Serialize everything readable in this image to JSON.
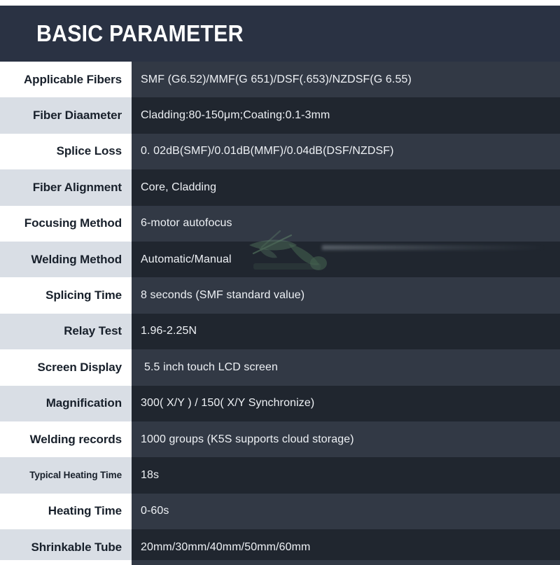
{
  "header": {
    "title": "BASIC PARAMETER"
  },
  "table": {
    "rows": [
      {
        "label": "Applicable Fibers",
        "value": "SMF (G6.52)/MMF(G 651)/DSF(.653)/NZDSF(G 6.55)"
      },
      {
        "label": "Fiber Diaameter",
        "value": "Cladding:80-150μm;Coating:0.1-3mm"
      },
      {
        "label": "Splice Loss",
        "value": "0. 02dB(SMF)/0.01dB(MMF)/0.04dB(DSF/NZDSF)"
      },
      {
        "label": "Fiber Alignment",
        "value": "Core, Cladding"
      },
      {
        "label": "Focusing Method",
        "value": "6-motor autofocus"
      },
      {
        "label": "Welding Method",
        "value": "Automatic/Manual"
      },
      {
        "label": "Splicing Time",
        "value": "8 seconds (SMF standard value)"
      },
      {
        "label": "Relay Test",
        "value": "1.96-2.25N"
      },
      {
        "label": "Screen Display",
        "value": "5.5 inch touch LCD screen"
      },
      {
        "label": "Magnification",
        "value": "300( X/Y ) / 150( X/Y  Synchronize)"
      },
      {
        "label": "Welding records",
        "value": "1000 groups (K5S supports cloud storage)"
      },
      {
        "label": "Typical Heating Time",
        "value": "18s"
      },
      {
        "label": "Heating Time",
        "value": "0-60s"
      },
      {
        "label": "Shrinkable Tube",
        "value": "20mm/30mm/40mm/50mm/60mm"
      }
    ]
  },
  "colors": {
    "banner_background": "#2a3243",
    "banner_text": "#ffffff",
    "label_row_light": "#ffffff",
    "label_row_shaded": "#d9dee5",
    "label_text": "#18202b",
    "value_row_light": "#323945",
    "value_row_dark": "#20262f",
    "value_text": "#eef1f5",
    "watermark_green": "#5c8f63"
  }
}
